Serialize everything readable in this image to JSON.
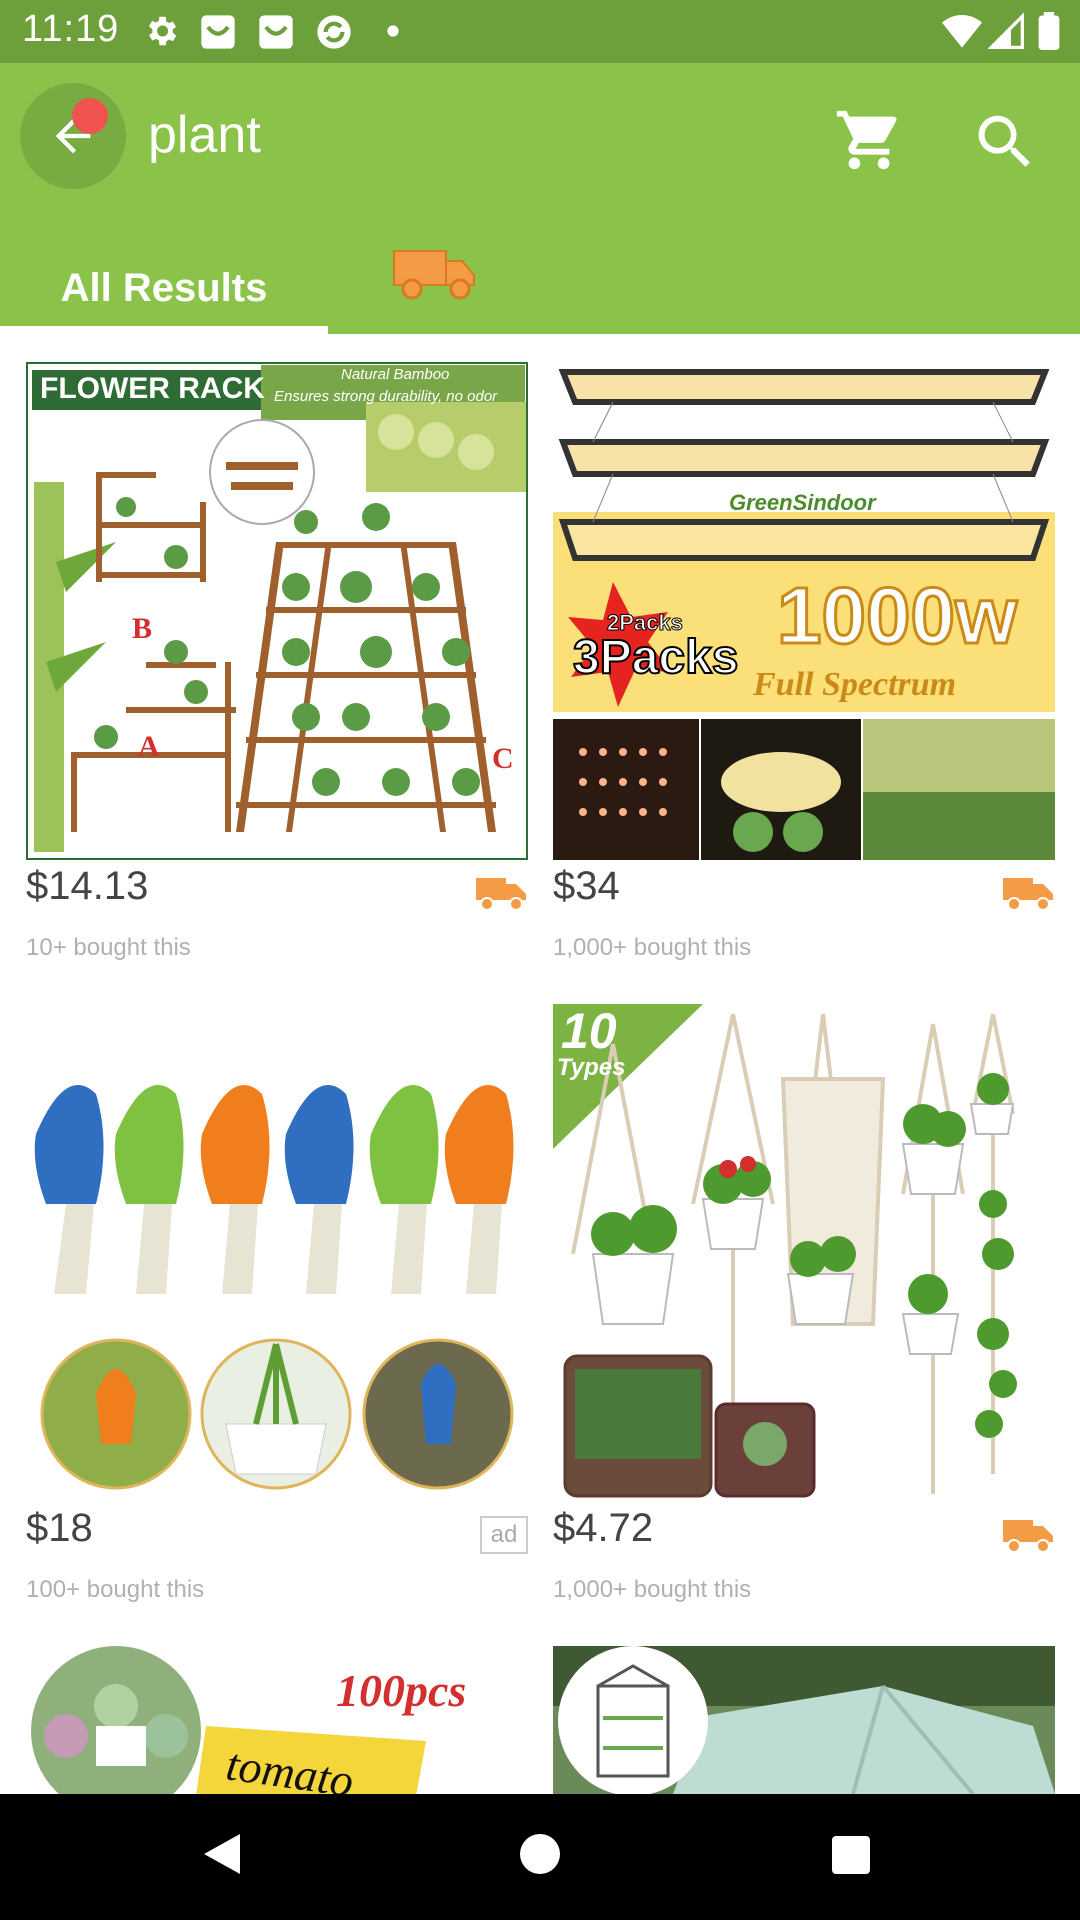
{
  "status_bar": {
    "time": "11:19"
  },
  "search": {
    "query": "plant"
  },
  "tabs": [
    {
      "label": "All Results"
    }
  ],
  "products": [
    {
      "price": "$14.13",
      "bought": "10+ bought this",
      "badge": "shipping",
      "image_text": {
        "banner": "FLOWER RACK",
        "sub1": "Natural Bamboo",
        "sub2": "Ensures strong durability, no odor",
        "a": "A",
        "b": "B",
        "c": "C"
      }
    },
    {
      "price": "$34",
      "bought": "1,000+ bought this",
      "badge": "shipping",
      "image_text": {
        "brand": "GreenSindoor",
        "watt": "1000w",
        "spectrum": "Full Spectrum",
        "packs_top": "2Packs",
        "packs_main": "3Packs"
      }
    },
    {
      "price": "$18",
      "bought": "100+ bought this",
      "badge": "ad",
      "image_text": {}
    },
    {
      "price": "$4.72",
      "bought": "1,000+ bought this",
      "badge": "shipping",
      "image_text": {
        "count": "10",
        "types": "Types"
      }
    },
    {
      "price": "",
      "bought": "",
      "badge": "",
      "image_text": {
        "pcs": "100pcs",
        "tag": "tomato"
      }
    },
    {
      "price": "",
      "bought": "",
      "badge": "",
      "image_text": {}
    }
  ],
  "ad_label": "ad",
  "colors": {
    "status_bar": "#6d9f3a",
    "app_bar": "#8bc34a",
    "accent": "#f39c45",
    "notification": "#ef5350"
  }
}
